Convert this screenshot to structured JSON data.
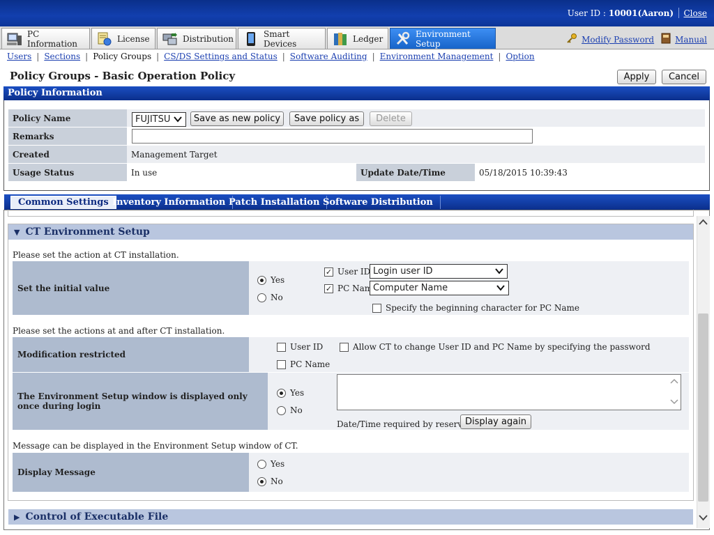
{
  "header": {
    "user_prefix": "User ID : ",
    "user_value": "10001(Aaron)",
    "close": "Close"
  },
  "tabs": [
    {
      "label": "PC Information",
      "icon": "pc-icon"
    },
    {
      "label": "License",
      "icon": "license-icon"
    },
    {
      "label": "Distribution",
      "icon": "distribution-icon"
    },
    {
      "label": "Smart Devices",
      "icon": "smartphone-icon"
    },
    {
      "label": "Ledger",
      "icon": "ledger-icon"
    },
    {
      "label": "Environment Setup",
      "icon": "tools-icon"
    }
  ],
  "right_links": {
    "modify_password": "Modify Password",
    "manual": "Manual"
  },
  "subnav": {
    "users": "Users",
    "sections": "Sections",
    "policy_groups": "Policy Groups",
    "csds": "CS/DS Settings and Status",
    "software_auditing": "Software Auditing",
    "environment_management": "Environment Management",
    "option": "Option"
  },
  "page": {
    "title": "Policy Groups - Basic Operation Policy",
    "apply": "Apply",
    "cancel": "Cancel"
  },
  "policy_info": {
    "header": "Policy Information",
    "policy_name_label": "Policy Name",
    "policy_name_value": "FUJITSU",
    "save_new": "Save as new policy",
    "save_as": "Save policy as",
    "delete": "Delete",
    "remarks_label": "Remarks",
    "remarks_value": "",
    "created_label": "Created",
    "created_value": "Management Target",
    "usage_label": "Usage Status",
    "usage_value": "In use",
    "update_label": "Update Date/Time",
    "update_value": "05/18/2015 10:39:43"
  },
  "settings_tabs": [
    "Common Settings",
    "Inventory Information",
    "Patch Installation",
    "Software Distribution"
  ],
  "ct_setup": {
    "title": "CT Environment Setup",
    "intro1": "Please set the action at CT installation.",
    "initial_label": "Set the initial value",
    "yes": "Yes",
    "no": "No",
    "user_id": "User ID",
    "user_id_select": "Login user ID",
    "pc_name": "PC Name",
    "pc_name_select": "Computer Name",
    "beginning_char": "Specify the beginning character for PC Name",
    "intro2": "Please set the actions at and after CT installation.",
    "mod_label": "Modification restricted",
    "allow_ct": "Allow CT to change User ID and PC Name by specifying the password",
    "once_label": "The Environment Setup window is displayed only once during login",
    "reservation": "Date/Time required by reservation:",
    "display_again": "Display again",
    "intro3": "Message can be displayed in the Environment Setup window of CT.",
    "display_msg_label": "Display Message"
  },
  "control_exec": {
    "title": "Control of Executable File"
  }
}
